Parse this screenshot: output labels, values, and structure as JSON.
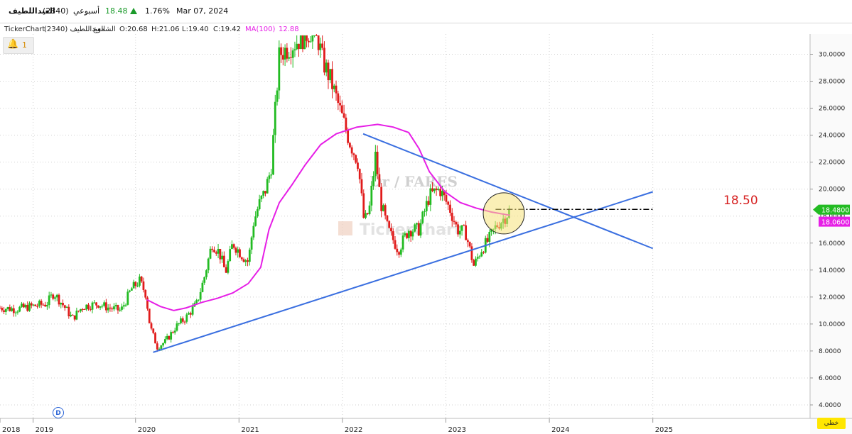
{
  "header": {
    "company": "العبداللطيف",
    "code": "(2340)",
    "period": "أسبوعي",
    "last_price": "18.48",
    "change_pct": "1.76%",
    "date": "Mar 07, 2024"
  },
  "info_bar": {
    "source": "TickerChart",
    "symbol": "العبداللطيف (2340)",
    "type": "الشموع",
    "open": "O:20.68",
    "high": "H:21.06",
    "low": "L:19.40",
    "close": "C:19.42",
    "ma_label": "MA(100)",
    "ma_value": "12.88"
  },
  "alerts": {
    "count": "1",
    "icon": "bell-icon"
  },
  "watermark": {
    "author": "Dr / FARES",
    "brand": "TickerChart"
  },
  "annotation": {
    "level_label": "18.50"
  },
  "price_tags": {
    "last": "18.4800",
    "ma": "18.0600"
  },
  "stoch_badge": "D",
  "corner_button": "خطي",
  "colors": {
    "up": "#22bb22",
    "down": "#e01b1b",
    "ma": "#e61ee6",
    "trendline": "#3a6fe0",
    "grid": "#d0d0d0",
    "highlight": "#f5e27a"
  },
  "chart_data": {
    "type": "candlestick",
    "ylim": [
      3,
      31.5
    ],
    "yticks": [
      "4.0000",
      "6.0000",
      "8.0000",
      "10.0000",
      "12.0000",
      "14.0000",
      "16.0000",
      "18.0000",
      "20.0000",
      "22.0000",
      "24.0000",
      "26.0000",
      "28.0000",
      "30.0000"
    ],
    "ytick_values": [
      4,
      6,
      8,
      10,
      12,
      14,
      16,
      18,
      20,
      22,
      24,
      26,
      28,
      30
    ],
    "xlim": [
      2018.0,
      2025.83
    ],
    "xticks": [
      {
        "label": "2018",
        "x": 2018.0
      },
      {
        "label": "2019",
        "x": 2018.32
      },
      {
        "label": "2020",
        "x": 2019.31
      },
      {
        "label": "2021",
        "x": 2020.31
      },
      {
        "label": "2022",
        "x": 2021.31
      },
      {
        "label": "2023",
        "x": 2022.31
      },
      {
        "label": "2024",
        "x": 2023.31
      },
      {
        "label": "2025",
        "x": 2024.31
      }
    ],
    "price_path": [
      [
        2018.0,
        11.2
      ],
      [
        2018.15,
        11.1
      ],
      [
        2018.3,
        11.3
      ],
      [
        2018.45,
        11.5
      ],
      [
        2018.52,
        12.3
      ],
      [
        2018.62,
        11.3
      ],
      [
        2018.7,
        10.4
      ],
      [
        2018.8,
        11.3
      ],
      [
        2018.95,
        11.5
      ],
      [
        2019.05,
        11.2
      ],
      [
        2019.17,
        11.0
      ],
      [
        2019.27,
        12.6
      ],
      [
        2019.35,
        13.2
      ],
      [
        2019.41,
        12.2
      ],
      [
        2019.45,
        9.8
      ],
      [
        2019.52,
        8.3
      ],
      [
        2019.6,
        8.7
      ],
      [
        2019.7,
        9.8
      ],
      [
        2019.8,
        10.5
      ],
      [
        2019.9,
        11.5
      ],
      [
        2019.97,
        13.3
      ],
      [
        2020.05,
        16.0
      ],
      [
        2020.12,
        15.3
      ],
      [
        2020.18,
        13.8
      ],
      [
        2020.25,
        16.0
      ],
      [
        2020.35,
        15.0
      ],
      [
        2020.4,
        14.6
      ],
      [
        2020.45,
        17.5
      ],
      [
        2020.5,
        18.8
      ],
      [
        2020.56,
        19.8
      ],
      [
        2020.62,
        21.5
      ],
      [
        2020.7,
        30.0
      ],
      [
        2021.05,
        32.0
      ],
      [
        2021.12,
        29.5
      ],
      [
        2021.2,
        28.0
      ],
      [
        2021.3,
        25.5
      ],
      [
        2021.38,
        23.5
      ],
      [
        2021.46,
        22.0
      ],
      [
        2021.52,
        17.5
      ],
      [
        2021.57,
        18.5
      ],
      [
        2021.63,
        22.5
      ],
      [
        2021.68,
        19.0
      ],
      [
        2021.75,
        17.0
      ],
      [
        2021.85,
        15.5
      ],
      [
        2021.95,
        17.0
      ],
      [
        2022.05,
        17.0
      ],
      [
        2022.15,
        19.5
      ],
      [
        2022.25,
        20.0
      ],
      [
        2022.35,
        18.5
      ],
      [
        2022.42,
        17.0
      ],
      [
        2022.5,
        16.8
      ],
      [
        2022.58,
        14.3
      ],
      [
        2022.65,
        15.5
      ],
      [
        2022.72,
        16.2
      ],
      [
        2022.8,
        17.3
      ],
      [
        2022.84,
        17.6
      ],
      [
        2022.89,
        18.0
      ],
      [
        2022.93,
        18.5
      ]
    ],
    "ma100": [
      [
        2019.42,
        11.8
      ],
      [
        2019.55,
        11.3
      ],
      [
        2019.68,
        11.0
      ],
      [
        2019.8,
        11.2
      ],
      [
        2019.95,
        11.6
      ],
      [
        2020.1,
        11.9
      ],
      [
        2020.25,
        12.3
      ],
      [
        2020.4,
        13.0
      ],
      [
        2020.52,
        14.2
      ],
      [
        2020.6,
        17.0
      ],
      [
        2020.7,
        19.0
      ],
      [
        2020.82,
        20.3
      ],
      [
        2020.95,
        21.8
      ],
      [
        2021.1,
        23.3
      ],
      [
        2021.25,
        24.1
      ],
      [
        2021.45,
        24.6
      ],
      [
        2021.65,
        24.8
      ],
      [
        2021.8,
        24.6
      ],
      [
        2021.95,
        24.2
      ],
      [
        2022.05,
        23.0
      ],
      [
        2022.15,
        21.3
      ],
      [
        2022.3,
        19.8
      ],
      [
        2022.45,
        19.0
      ],
      [
        2022.6,
        18.6
      ],
      [
        2022.75,
        18.3
      ],
      [
        2022.93,
        18.06
      ]
    ],
    "trendline_support": [
      [
        2019.48,
        7.9
      ],
      [
        2024.31,
        19.8
      ]
    ],
    "trendline_resistance": [
      [
        2021.51,
        24.1
      ],
      [
        2024.31,
        15.6
      ]
    ],
    "level_line": {
      "from": 2022.79,
      "to": 2024.31,
      "y": 18.5
    },
    "highlight": {
      "x": 2022.87,
      "y": 18.2
    },
    "last_price": 18.48,
    "ma_last": 18.06
  }
}
